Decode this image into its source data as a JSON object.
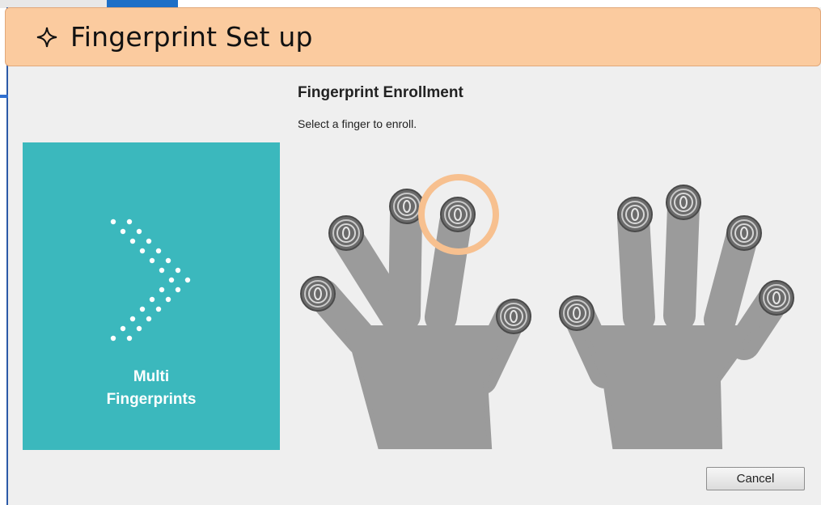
{
  "banner": {
    "icon": "sparkle-icon",
    "title": "Fingerprint Set up",
    "color": "#fbcb9f"
  },
  "enrollment": {
    "heading": "Fingerprint Enrollment",
    "instruction": "Select a finger to enroll."
  },
  "side_panel": {
    "icon": "chevron-dots-icon",
    "line1": "Multi",
    "line2": "Fingerprints",
    "color": "#3bb8bd"
  },
  "hands": {
    "left": {
      "fingers": [
        "pinky",
        "ring",
        "middle",
        "index",
        "thumb"
      ]
    },
    "right": {
      "fingers": [
        "thumb",
        "index",
        "middle",
        "ring",
        "pinky"
      ]
    },
    "highlighted_finger": "left-index",
    "highlight_color": "#f7c08f"
  },
  "buttons": {
    "cancel": "Cancel"
  }
}
